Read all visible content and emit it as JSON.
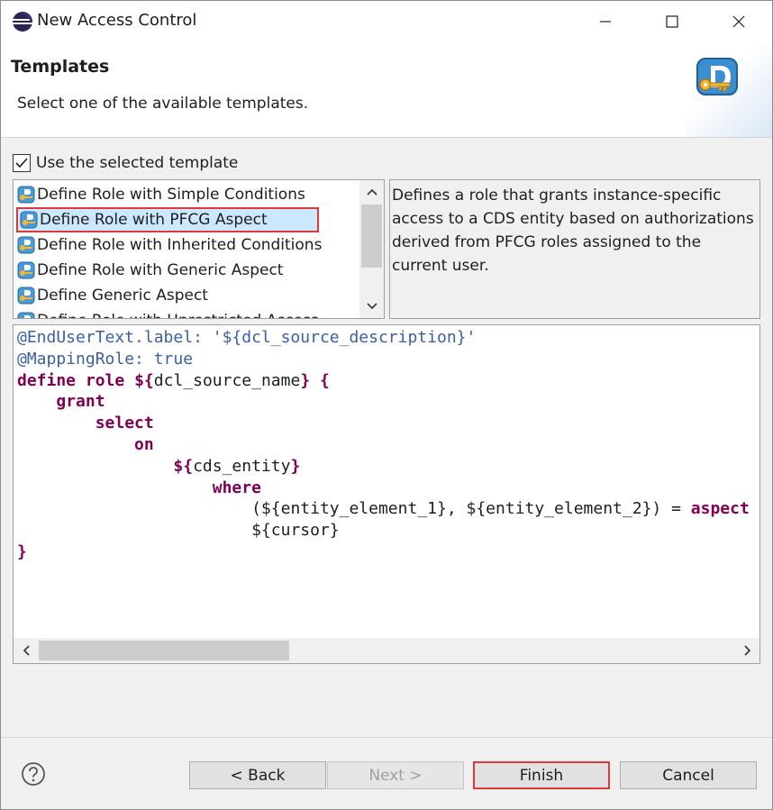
{
  "window": {
    "title": "New Access Control"
  },
  "banner": {
    "title": "Templates",
    "description": "Select one of the available templates."
  },
  "use_template": {
    "label": "Use the selected template",
    "checked": true
  },
  "templates": {
    "items": [
      {
        "label": "Define Role with Simple Conditions"
      },
      {
        "label": "Define Role with PFCG Aspect",
        "selected": true
      },
      {
        "label": "Define Role with Inherited Conditions"
      },
      {
        "label": "Define Role with Generic Aspect"
      },
      {
        "label": "Define Generic Aspect"
      },
      {
        "label": "Define Role with Unrestricted Access"
      }
    ],
    "description": "Defines a role that grants instance-specific access to a CDS entity based on authorizations derived from PFCG roles assigned to the current user."
  },
  "code": {
    "line1": "@EndUserText.label: '${dcl_source_description}'",
    "line2": "@MappingRole: true",
    "kw_define": "define",
    "kw_role": "role",
    "role_name": "${dcl_source_name}",
    "open_brace": "{",
    "kw_grant": "grant",
    "kw_select": "select",
    "kw_on": "on",
    "entity": "${cds_entity}",
    "kw_where": "where",
    "condition": "(${entity_element_1}, ${entity_element_2}) = ",
    "kw_aspect": "aspect",
    "cursor": "${cursor}",
    "close_brace": "}"
  },
  "buttons": {
    "back": "< Back",
    "next": "Next >",
    "finish": "Finish",
    "cancel": "Cancel"
  },
  "colors": {
    "selection_highlight": "#cce8ff",
    "highlight_border": "#e0373c",
    "annotation_blue": "#3c5fa0",
    "keyword_purple": "#7f0055"
  }
}
